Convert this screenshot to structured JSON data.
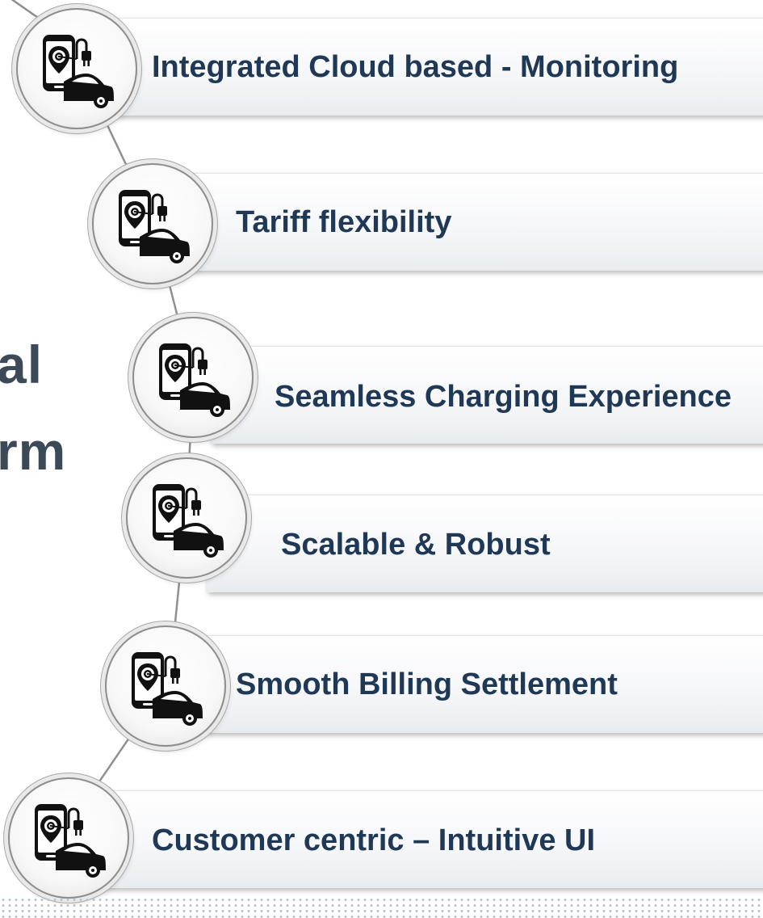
{
  "side_text": [
    "al",
    "rm"
  ],
  "features": [
    {
      "label": "Integrated Cloud based  - Monitoring",
      "icon": "ev-charging-icon"
    },
    {
      "label": "Tariff flexibility",
      "icon": "ev-charging-icon"
    },
    {
      "label": "Seamless Charging Experience",
      "icon": "ev-charging-icon"
    },
    {
      "label": "Scalable & Robust",
      "icon": "ev-charging-icon"
    },
    {
      "label": "Smooth Billing Settlement",
      "icon": "ev-charging-icon"
    },
    {
      "label": "Customer centric – Intuitive UI",
      "icon": "ev-charging-icon"
    }
  ],
  "colors": {
    "label": "#1f3856",
    "side_text": "#3c4a57",
    "connector": "#8f8f8f",
    "dots": "#b3c2d4"
  }
}
